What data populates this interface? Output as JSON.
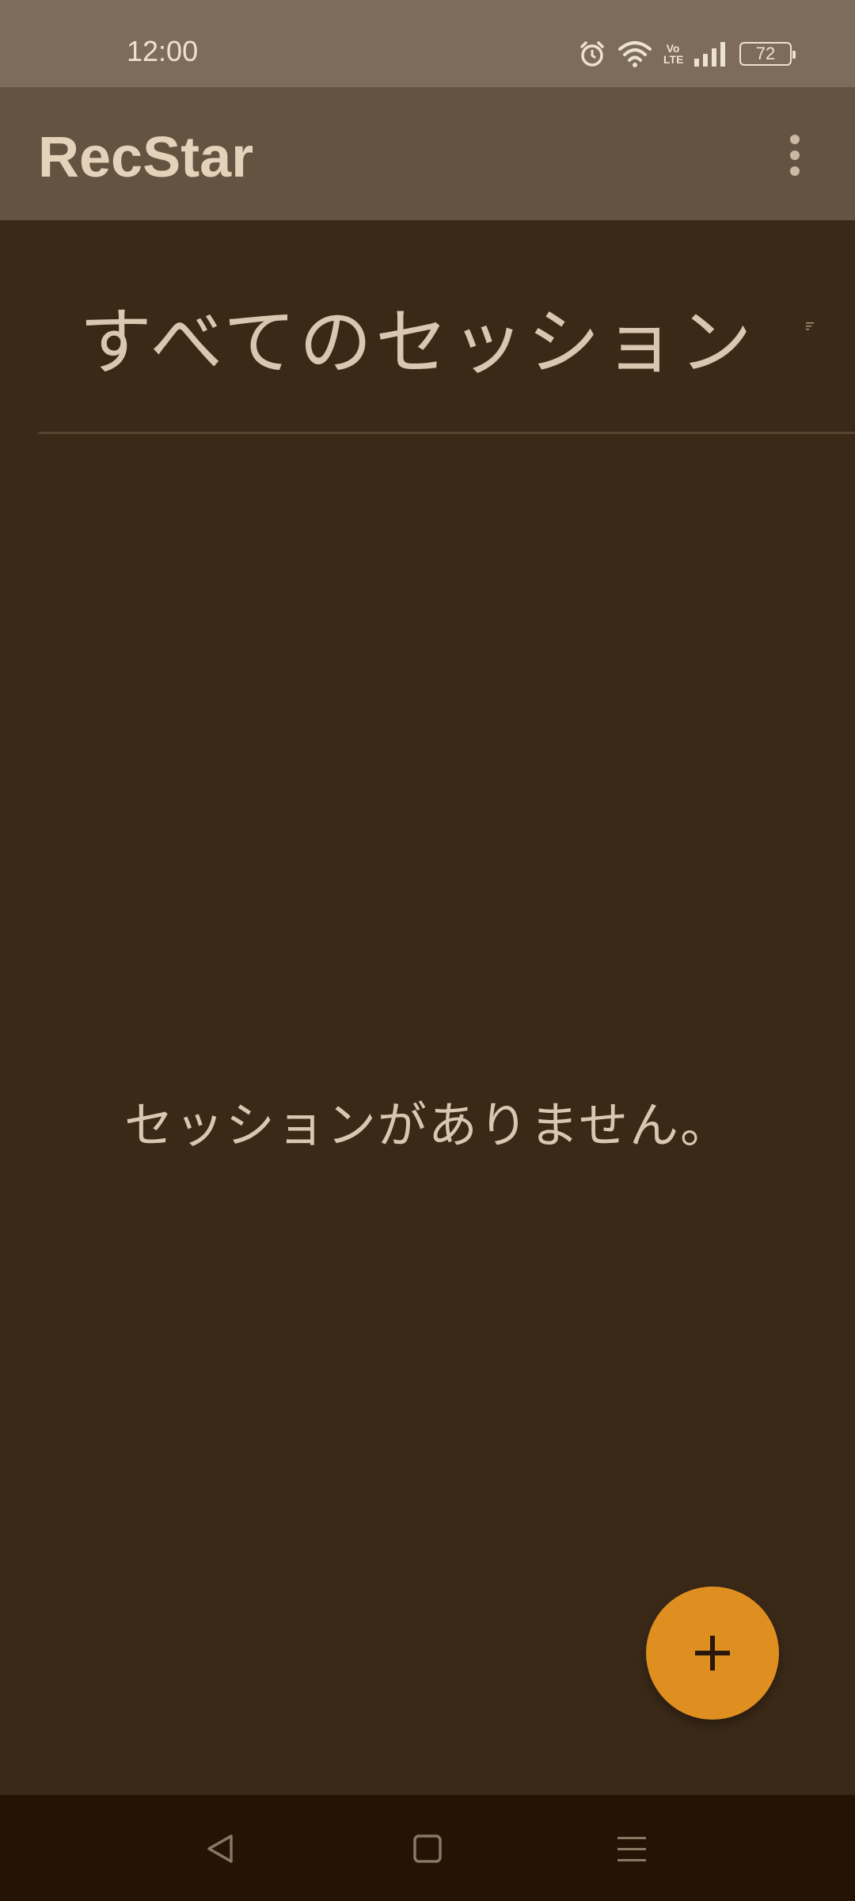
{
  "status_bar": {
    "time": "12:00",
    "volte_top": "Vo",
    "volte_bottom": "LTE",
    "battery": "72",
    "icons": [
      "alarm-icon",
      "wifi-icon",
      "volte-icon",
      "signal-icon",
      "battery-icon"
    ]
  },
  "app_bar": {
    "title": "RecStar",
    "menu_icon": "more-vert-icon"
  },
  "section": {
    "title": "すべてのセッション",
    "sort_icon": "sort-icon"
  },
  "empty_state": {
    "message": "セッションがありません。"
  },
  "fab": {
    "icon": "plus-icon"
  },
  "nav_bar": {
    "buttons": [
      "back-icon",
      "home-icon",
      "recents-icon"
    ]
  },
  "colors": {
    "status_bar": "#7d6c5a",
    "app_bar": "#645341",
    "background": "#3b2918",
    "text": "#d9c7b1",
    "accent": "#df8f20",
    "nav_bar": "#251406"
  }
}
